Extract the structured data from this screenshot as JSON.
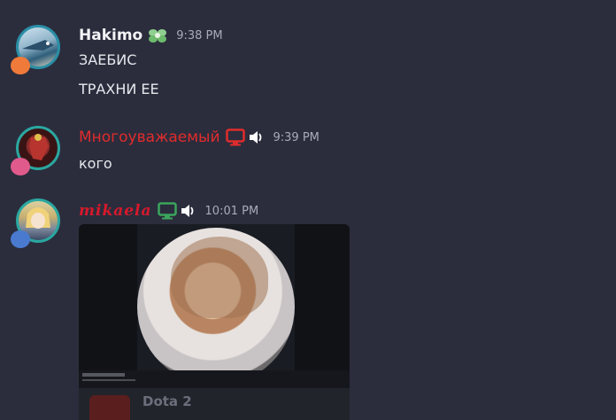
{
  "messages": [
    {
      "username": "Hakimo",
      "username_color": "#f2f3f5",
      "badge_icon": "leaf-flower-icon",
      "timestamp": "9:38 PM",
      "lines": [
        "ЗАЕБИС",
        "ТРАХНИ ЕЕ"
      ]
    },
    {
      "username": "Многоуважаемый",
      "username_color": "#e02c2c",
      "icons": [
        "monitor-icon",
        "speaker-icon"
      ],
      "timestamp": "9:39 PM",
      "lines": [
        "кого"
      ]
    },
    {
      "username": "mikaela",
      "username_color": "#d6192b",
      "icons": [
        "monitor-icon",
        "speaker-icon"
      ],
      "timestamp": "10:01 PM",
      "lines": [],
      "attachment": {
        "type": "video-embed",
        "activity_game": "Dota 2"
      }
    }
  ],
  "colors": {
    "background": "#2b2d3d",
    "timestamp": "#a9abb8",
    "text": "#e6e7ec",
    "monitor_red": "#e02c2c",
    "monitor_green": "#3ba55c"
  }
}
